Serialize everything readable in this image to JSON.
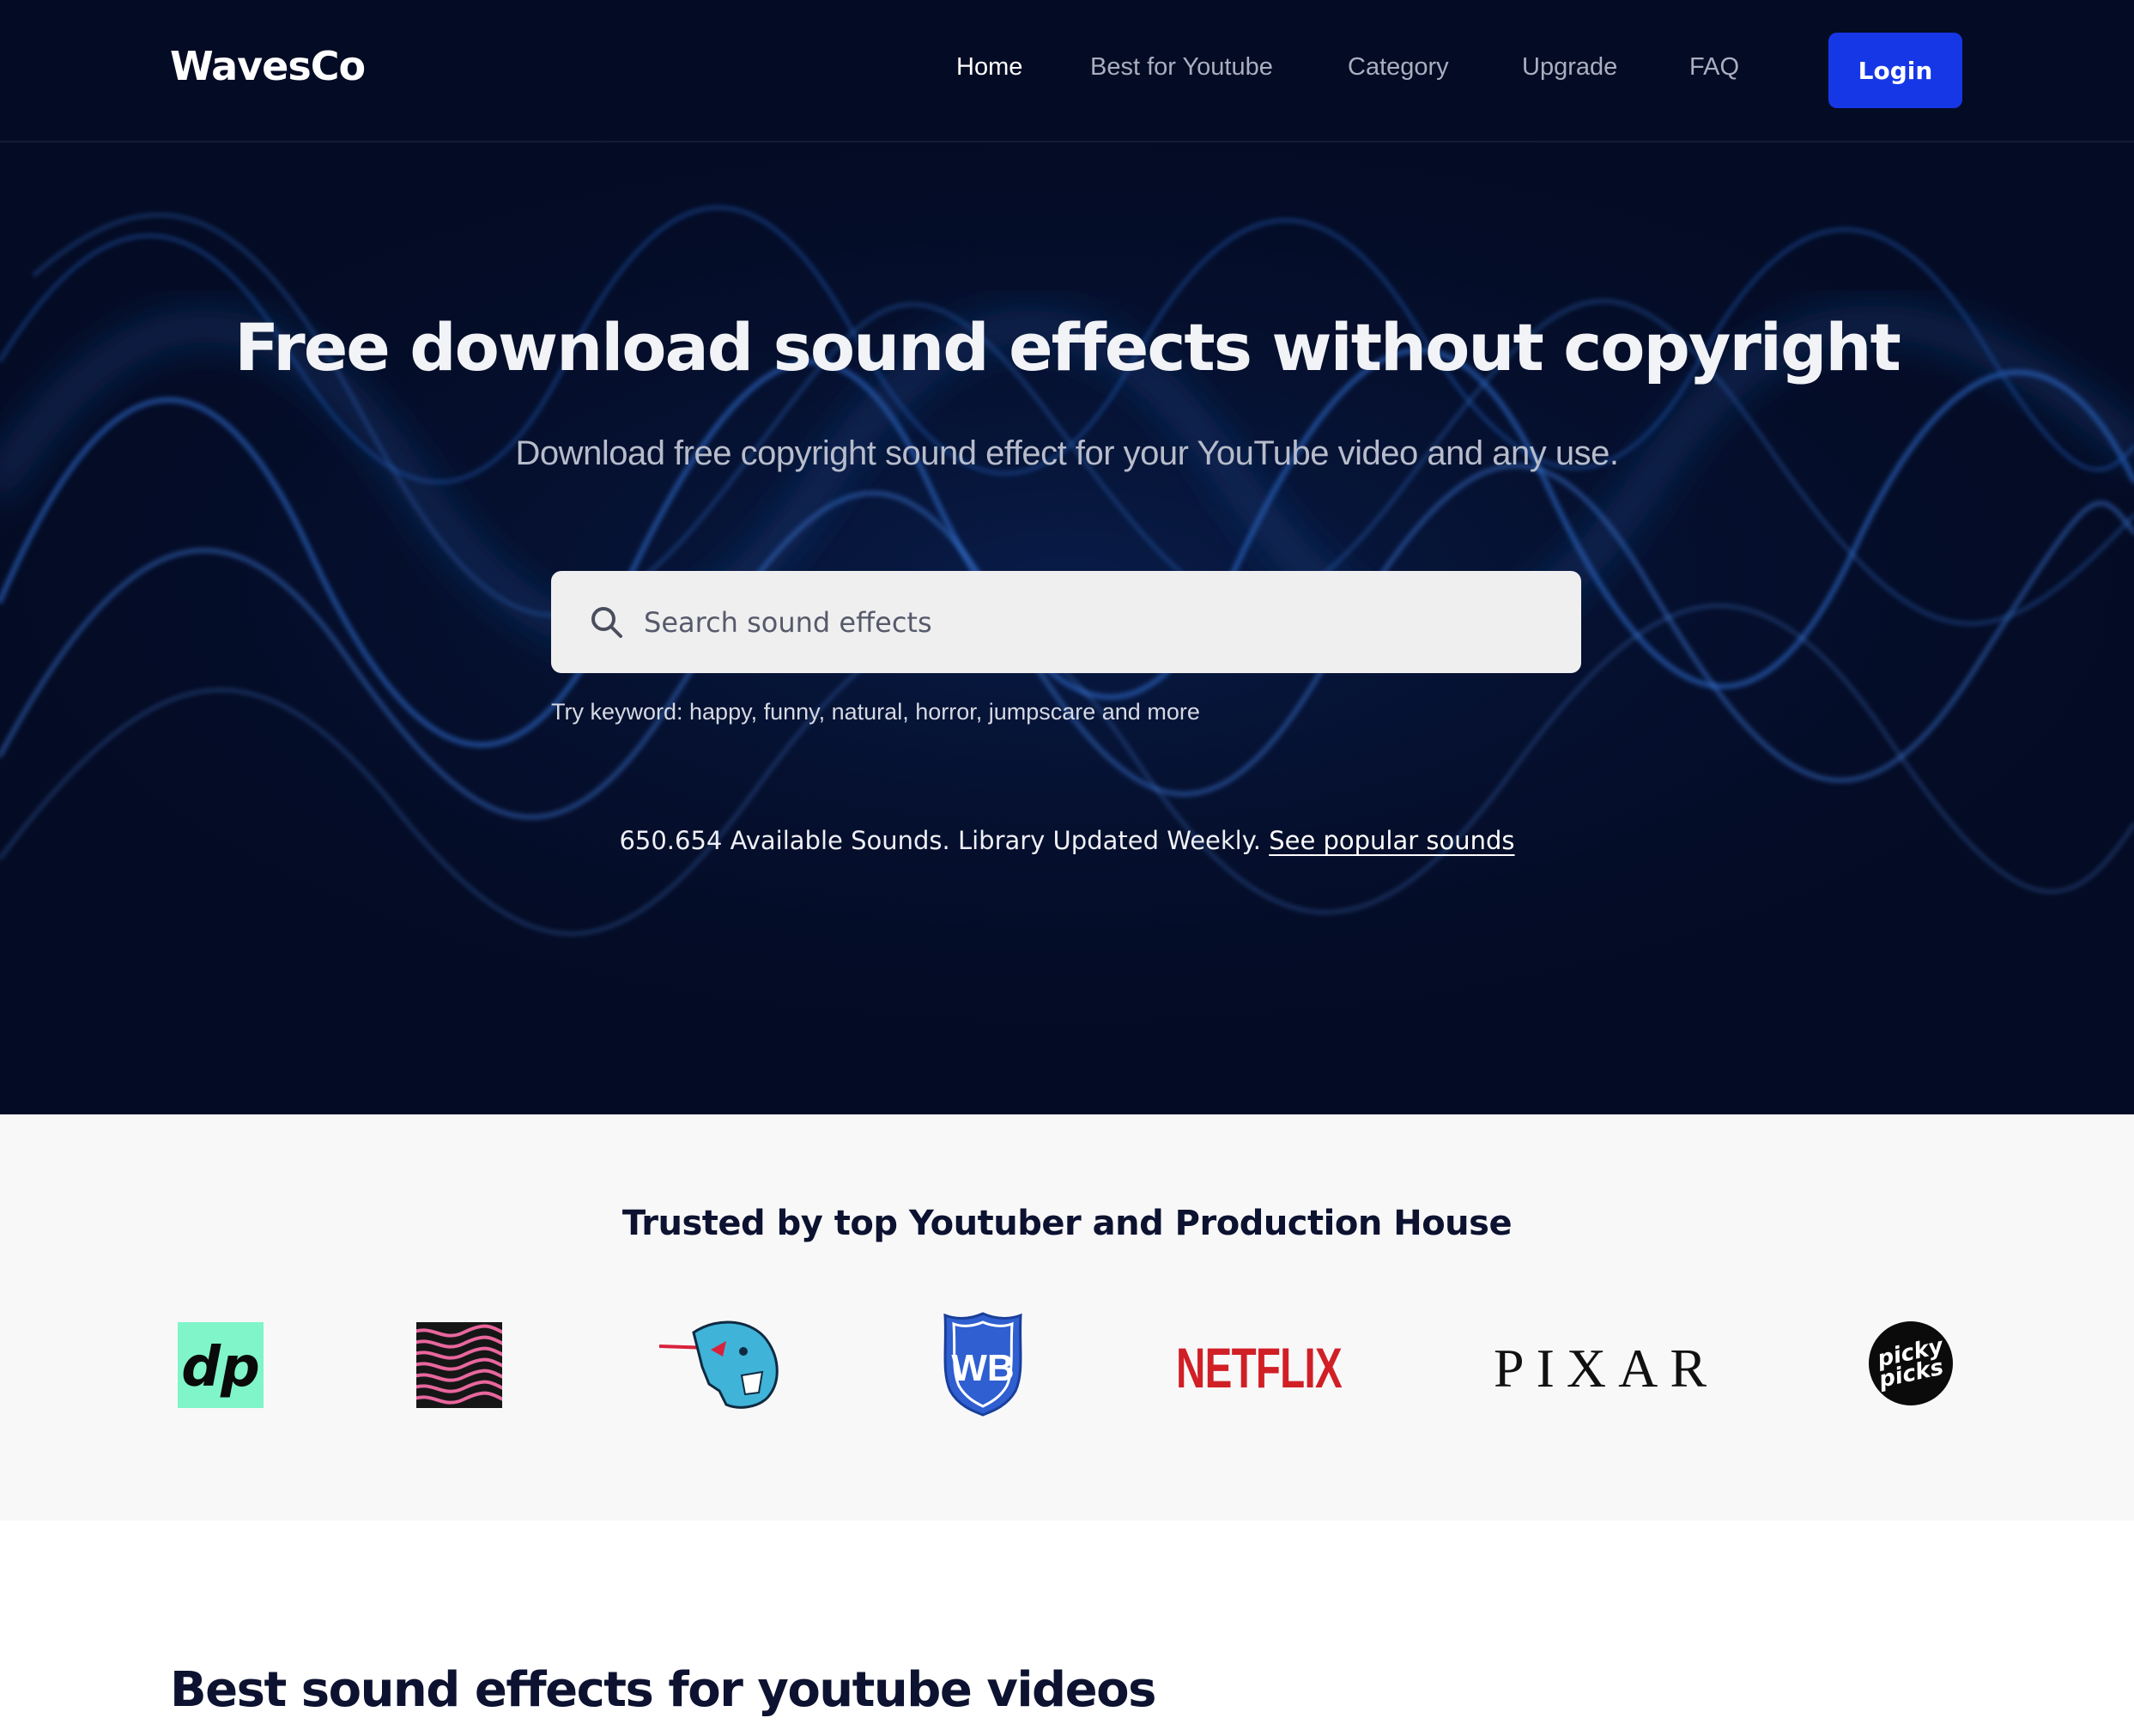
{
  "brand": {
    "name": "WavesCo"
  },
  "nav": {
    "items": [
      {
        "label": "Home",
        "active": true
      },
      {
        "label": "Best for Youtube",
        "active": false
      },
      {
        "label": "Category",
        "active": false
      },
      {
        "label": "Upgrade",
        "active": false
      },
      {
        "label": "FAQ",
        "active": false
      }
    ],
    "login_label": "Login"
  },
  "hero": {
    "title": "Free download sound effects without copyright",
    "subtitle": "Download free copyright sound effect for your YouTube video and any use.",
    "search": {
      "placeholder": "Search sound effects",
      "value": ""
    },
    "keyword_hint": "Try keyword: happy, funny, natural, horror, jumpscare and more",
    "stats_text": "650.654 Available Sounds. Library Updated Weekly.",
    "stats_link": "See popular sounds"
  },
  "trusted": {
    "title": "Trusted by top Youtuber and Production House",
    "logos": [
      {
        "name": "dude-perfect-logo",
        "text": "dp"
      },
      {
        "name": "wavy-pattern-logo"
      },
      {
        "name": "mrbeast-logo"
      },
      {
        "name": "warner-bros-logo",
        "text": "WB"
      },
      {
        "name": "netflix-logo",
        "text": "NETFLIX"
      },
      {
        "name": "pixar-logo",
        "text": "PIXAR"
      },
      {
        "name": "picky-picks-logo",
        "text": "picky picks"
      }
    ]
  },
  "best": {
    "title": "Best sound effects for youtube videos"
  },
  "colors": {
    "hero_bg": "#040b24",
    "accent": "#1637e6",
    "heading_dark": "#0c1230",
    "netflix_red": "#d11f26"
  }
}
